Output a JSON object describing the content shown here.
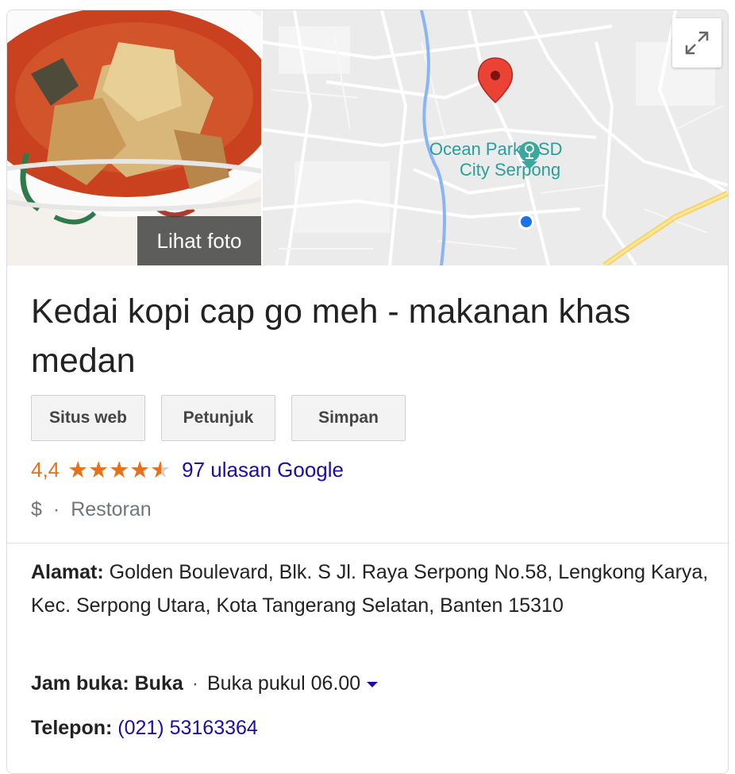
{
  "photo": {
    "label": "Lihat foto"
  },
  "map": {
    "place_label_line1": "Ocean Park BSD",
    "place_label_line2": "City Serpong"
  },
  "place": {
    "title": "Kedai kopi cap go meh - makanan khas medan",
    "rating": "4,4",
    "stars_value": 4.4,
    "stars_max": 5,
    "reviews": "97 ulasan Google",
    "price": "$",
    "category": "Restoran"
  },
  "actions": {
    "website": "Situs web",
    "directions": "Petunjuk",
    "save": "Simpan"
  },
  "details": {
    "address_label": "Alamat:",
    "address_value": "Golden Boulevard, Blk. S Jl. Raya Serpong No.58, Lengkong Karya, Kec. Serpong Utara, Kota Tangerang Selatan, Banten 15310",
    "hours_label": "Jam buka:",
    "hours_status": "Buka",
    "hours_separator": "·",
    "hours_detail": "Buka pukul 06.00",
    "phone_label": "Telepon:",
    "phone_value": "(021) 53163364"
  },
  "icons": {
    "expand": "expand-icon",
    "pin": "map-pin-icon",
    "amusement": "amusement-park-icon",
    "location": "current-location-icon",
    "dropdown": "chevron-down-icon"
  },
  "colors": {
    "rating": "#e7711b",
    "link": "#1a0dab",
    "pin": "#ea4335",
    "poi": "#2a9d9b"
  }
}
